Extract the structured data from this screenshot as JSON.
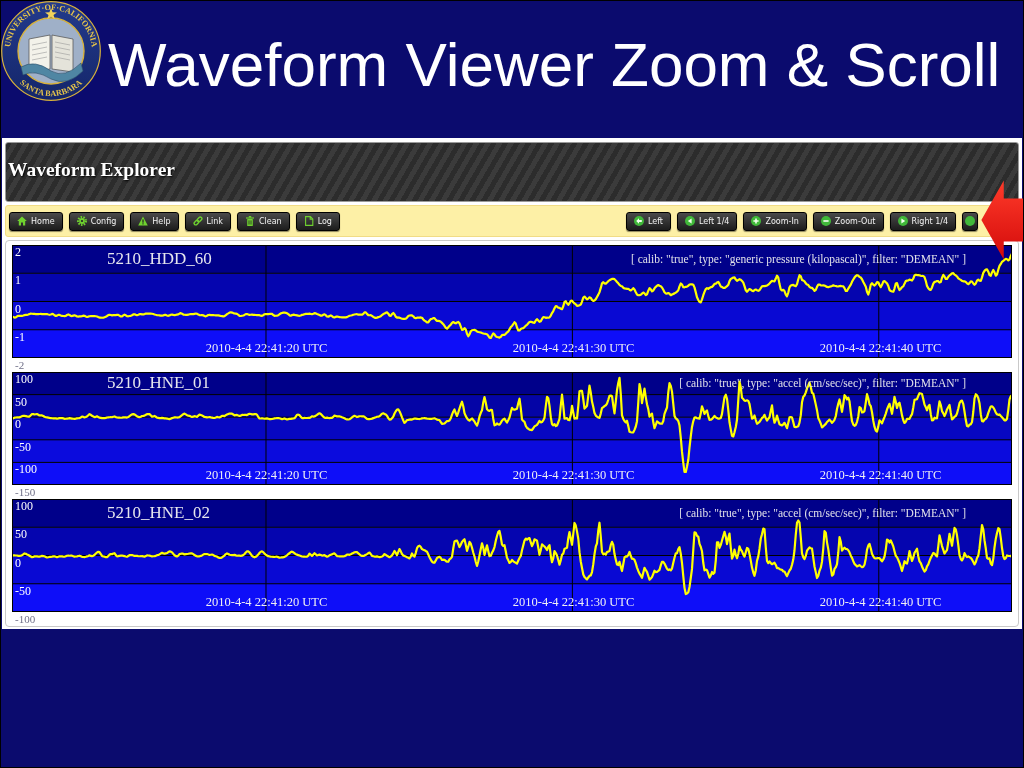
{
  "slide": {
    "title": "Waveform Viewer Zoom & Scroll",
    "seal": {
      "top_text": "UNIVERSITY·OF·CALIFORNIA",
      "bottom_text": "SANTA BARBARA"
    }
  },
  "app": {
    "title": "Waveform Explorer",
    "toolbar": {
      "left_buttons": [
        {
          "label": "Home"
        },
        {
          "label": "Config"
        },
        {
          "label": "Help"
        },
        {
          "label": "Link"
        },
        {
          "label": "Clean"
        },
        {
          "label": "Log"
        }
      ],
      "right_buttons": [
        {
          "kind": "labeled",
          "label": "Left"
        },
        {
          "kind": "labeled",
          "label": "Left 1/4"
        },
        {
          "kind": "labeled",
          "label": "Zoom-In"
        },
        {
          "kind": "labeled",
          "label": "Zoom-Out"
        },
        {
          "kind": "labeled",
          "label": "Right 1/4"
        },
        {
          "kind": "icon_only"
        }
      ]
    },
    "panels": [
      {
        "kind": "pressure",
        "station": "5210_HDD_60",
        "info": "[ calib: \"true\", type: \"generic pressure (kilopascal)\", filter: \"DEMEAN\" ]",
        "y_labels": [
          "2",
          "1",
          "0",
          "-1",
          "-2"
        ],
        "time_labels": [
          "2010-4-4 22:41:20 UTC",
          "2010-4-4 22:41:30 UTC",
          "2010-4-4 22:41:40 UTC"
        ]
      },
      {
        "kind": "acceleration",
        "station": "5210_HNE_01",
        "info": "[ calib: \"true\", type: \"accel (cm/sec/sec)\", filter: \"DEMEAN\" ]",
        "y_labels": [
          "100",
          "50",
          "0",
          "-50",
          "-100",
          "-150"
        ],
        "time_labels": [
          "2010-4-4 22:41:20 UTC",
          "2010-4-4 22:41:30 UTC",
          "2010-4-4 22:41:40 UTC"
        ]
      },
      {
        "kind": "acceleration",
        "station": "5210_HNE_02",
        "info": "[ calib: \"true\", type: \"accel (cm/sec/sec)\", filter: \"DEMEAN\" ]",
        "y_labels": [
          "100",
          "50",
          "0",
          "-50",
          "-100"
        ],
        "time_labels": [
          "2010-4-4 22:41:20 UTC",
          "2010-4-4 22:41:30 UTC",
          "2010-4-4 22:41:40 UTC"
        ]
      }
    ]
  }
}
